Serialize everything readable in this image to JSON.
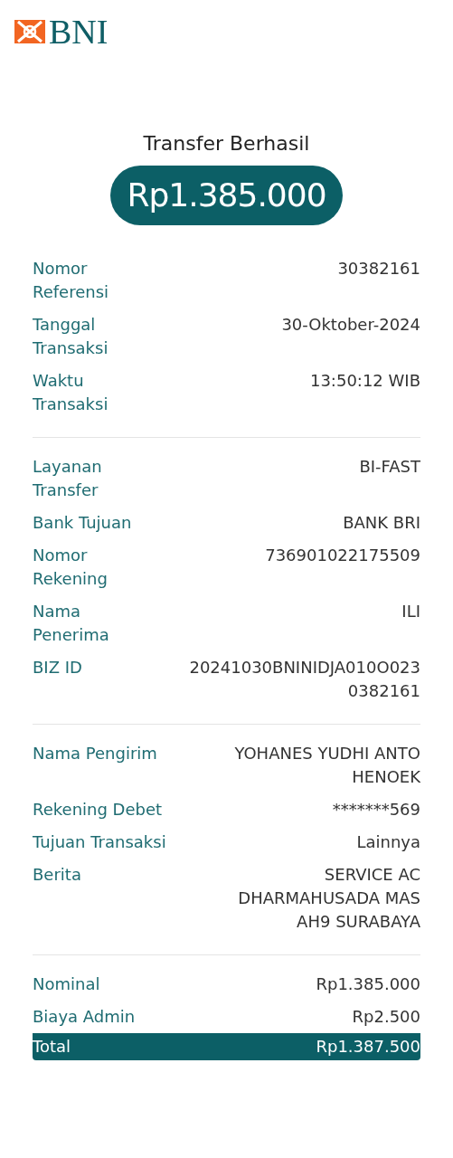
{
  "logo": {
    "text": "BNI"
  },
  "title": "Transfer Berhasil",
  "amount": "Rp1.385.000",
  "sections": [
    {
      "rows": [
        {
          "label": "Nomor Referensi",
          "value": "30382161",
          "highlighted": false
        },
        {
          "label": "Tanggal Transaksi",
          "value": "30-Oktober-2024",
          "highlighted": false
        },
        {
          "label": "Waktu Transaksi",
          "value": "13:50:12 WIB",
          "highlighted": false
        }
      ]
    },
    {
      "rows": [
        {
          "label": "Layanan Transfer",
          "value": "BI-FAST",
          "highlighted": false
        },
        {
          "label": "Bank Tujuan",
          "value": "BANK BRI",
          "highlighted": false
        },
        {
          "label": "Nomor Rekening",
          "value": "736901022175509",
          "highlighted": false
        },
        {
          "label": "Nama Penerima",
          "value": "ILI",
          "highlighted": false
        },
        {
          "label": "BIZ ID",
          "value": "20241030BNINIDJA010O0230382161",
          "highlighted": false
        }
      ]
    },
    {
      "rows": [
        {
          "label": "Nama Pengirim",
          "value": "YOHANES YUDHI ANTO HENOEK",
          "highlighted": false
        },
        {
          "label": "Rekening Debet",
          "value": "*******569",
          "highlighted": false
        },
        {
          "label": "Tujuan Transaksi",
          "value": "Lainnya",
          "highlighted": false
        },
        {
          "label": "Berita",
          "value": "SERVICE AC DHARMAHUSADA MAS AH9 SURABAYA",
          "highlighted": false
        }
      ]
    },
    {
      "rows": [
        {
          "label": "Nominal",
          "value": "Rp1.385.000",
          "highlighted": false
        },
        {
          "label": "Biaya Admin",
          "value": "Rp2.500",
          "highlighted": false
        },
        {
          "label": "Total",
          "value": "Rp1.387.500",
          "highlighted": true
        }
      ]
    }
  ]
}
